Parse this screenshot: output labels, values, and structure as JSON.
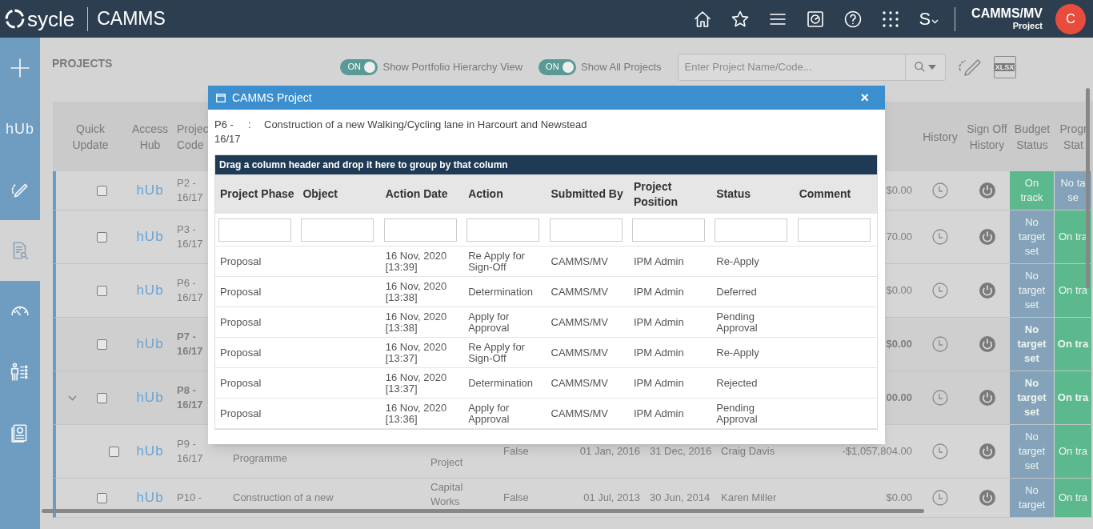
{
  "top_bar": {
    "logo": "sycle",
    "app_name": "CAMMS",
    "nav_icons": [
      {
        "kind": "home"
      },
      {
        "kind": "star"
      },
      {
        "kind": "menu"
      },
      {
        "kind": "dashboard"
      },
      {
        "kind": "help"
      },
      {
        "kind": "apps"
      }
    ],
    "switcher": "S",
    "user": "CAMMS/MV",
    "role": "Project",
    "avatar": "C"
  },
  "sidebar": {
    "items": [
      {
        "kind": "add",
        "selected": false
      },
      {
        "kind": "hub",
        "label": "hUb",
        "selected": false
      },
      {
        "kind": "edit",
        "selected": false
      },
      {
        "kind": "search-doc",
        "selected": true
      },
      {
        "kind": "gauge",
        "selected": false
      },
      {
        "kind": "people",
        "selected": false
      },
      {
        "kind": "report",
        "selected": false
      }
    ]
  },
  "toolbar": {
    "title": "PROJECTS",
    "toggles": [
      {
        "state": "ON",
        "on": true,
        "label": "Show Portfolio Hierarchy View"
      },
      {
        "state": "ON",
        "on": true,
        "label": "Show All Projects"
      }
    ],
    "search": {
      "placeholder": "Enter Project Name/Code..."
    },
    "export_label": "XLSX"
  },
  "table": {
    "columns_left": [
      "Quick Update",
      "Access Hub",
      "Projec Code"
    ],
    "columns_right": [
      "History",
      "Sign Off History",
      "Budget Status",
      "Progr Stat"
    ],
    "rows": [
      {
        "kind": "plain",
        "emphasized": false,
        "checked": false,
        "hub": "hUb",
        "code": "P2 - 16/17",
        "amount": "$0.00",
        "budget": {
          "text": "On track",
          "color": "#5cb98e"
        },
        "progress": {
          "text": "No ta se",
          "color": "#84a2b9"
        }
      },
      {
        "kind": "plain",
        "emphasized": false,
        "checked": false,
        "hub": "hUb",
        "code": "P3 - 16/17",
        "amount": "70.00",
        "budget": {
          "text": "No target set",
          "color": "#84a2b9"
        },
        "progress": {
          "text": "On tra",
          "color": "#5cb98e"
        }
      },
      {
        "kind": "plain",
        "emphasized": false,
        "checked": false,
        "hub": "hUb",
        "code": "P6 - 16/17",
        "amount": "$0.00",
        "budget": {
          "text": "No target set",
          "color": "#84a2b9"
        },
        "progress": {
          "text": "On tra",
          "color": "#5cb98e"
        }
      },
      {
        "kind": "plain",
        "emphasized": true,
        "checked": false,
        "hub": "hUb",
        "code": "P7 - 16/17",
        "amount": "$0.00",
        "budget": {
          "text": "No target set",
          "color": "#84a2b9"
        },
        "progress": {
          "text": "On tra",
          "color": "#5cb98e"
        }
      },
      {
        "kind": "parent",
        "emphasized": true,
        "checked": false,
        "hub": "hUb",
        "code": "P8 - 16/17",
        "amount": "00.00",
        "budget": {
          "text": "No target set",
          "color": "#84a2b9"
        },
        "progress": {
          "text": "On tra",
          "color": "#5cb98e"
        }
      },
      {
        "kind": "child",
        "emphasized": false,
        "checked": false,
        "hub": "hUb",
        "code": "P9 - 16/17",
        "name": "Programme",
        "type": "Project",
        "flag": "False",
        "start": "01 Jan, 2016",
        "end": "31 Dec, 2016",
        "manager": "Craig Davis",
        "amount": "-$1,057,804.00",
        "budget": {
          "text": "No target set",
          "color": "#84a2b9"
        },
        "progress": {
          "text": "On tra",
          "color": "#5cb98e"
        }
      },
      {
        "kind": "plain",
        "emphasized": false,
        "checked": false,
        "hub": "hUb",
        "code": "P10 -",
        "name": "Construction of a new",
        "type": "Capital Works",
        "flag": "False",
        "start": "01 Jul, 2013",
        "end": "30 Jun, 2014",
        "manager": "Karen Miller",
        "amount": "$0.00",
        "budget": {
          "text": "No target",
          "color": "#84a2b9"
        },
        "progress": {
          "text": "On tra",
          "color": "#5cb98e"
        }
      }
    ]
  },
  "modal": {
    "title": "CAMMS Project",
    "close": "×",
    "project_code": "P6 - 16/17",
    "separator": ":",
    "project_name": "Construction of a new Walking/Cycling lane in Harcourt and Newstead",
    "group_hint": "Drag a column header and drop it here to group by that column",
    "columns": [
      "Project Phase",
      "Object",
      "Action Date",
      "Action",
      "Submitted By",
      "Project Position",
      "Status",
      "Comment"
    ],
    "rows": [
      {
        "phase": "Proposal",
        "date": "16 Nov, 2020 [13:39]",
        "action": "Re Apply for Sign-Off",
        "submitted_by": "CAMMS/MV",
        "position": "IPM Admin",
        "status": "Re-Apply"
      },
      {
        "phase": "Proposal",
        "date": "16 Nov, 2020 [13:38]",
        "action": "Determination",
        "submitted_by": "CAMMS/MV",
        "position": "IPM Admin",
        "status": "Deferred"
      },
      {
        "phase": "Proposal",
        "date": "16 Nov, 2020 [13:38]",
        "action": "Apply for Approval",
        "submitted_by": "CAMMS/MV",
        "position": "IPM Admin",
        "status": "Pending Approval"
      },
      {
        "phase": "Proposal",
        "date": "16 Nov, 2020 [13:37]",
        "action": "Re Apply for Sign-Off",
        "submitted_by": "CAMMS/MV",
        "position": "IPM Admin",
        "status": "Re-Apply"
      },
      {
        "phase": "Proposal",
        "date": "16 Nov, 2020 [13:37]",
        "action": "Determination",
        "submitted_by": "CAMMS/MV",
        "position": "IPM Admin",
        "status": "Rejected"
      },
      {
        "phase": "Proposal",
        "date": "16 Nov, 2020 [13:36]",
        "action": "Apply for Approval",
        "submitted_by": "CAMMS/MV",
        "position": "IPM Admin",
        "status": "Pending Approval"
      }
    ]
  }
}
